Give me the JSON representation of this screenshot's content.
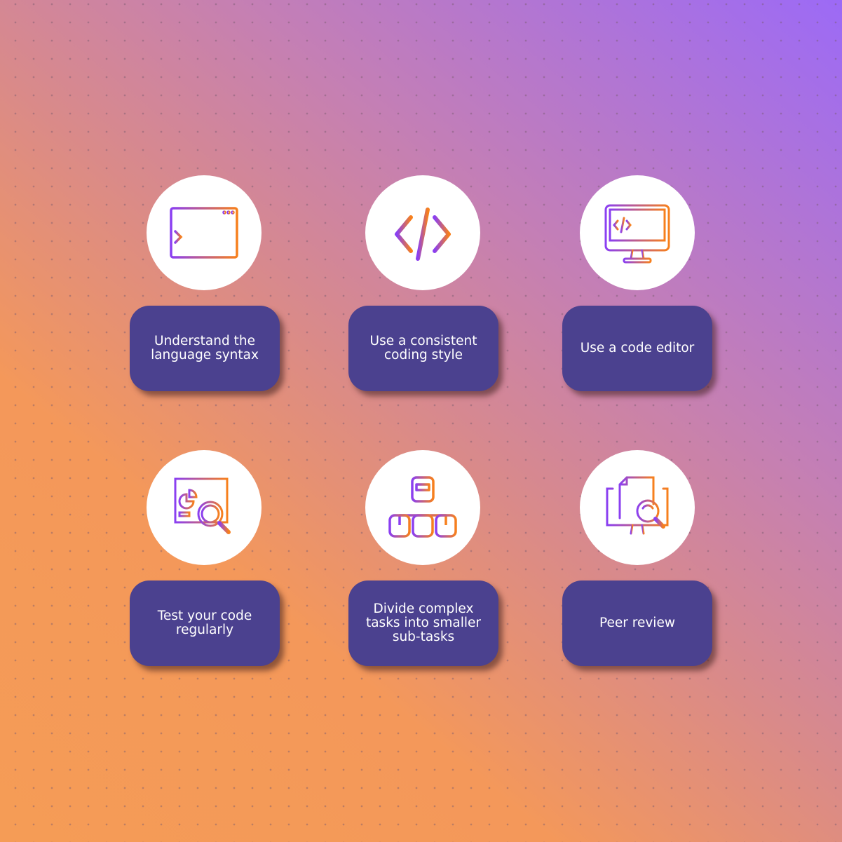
{
  "colors": {
    "card": "#4b418f",
    "icon_start": "#8a3ff2",
    "icon_end": "#f7801c",
    "bg_start": "#f59c56",
    "bg_end": "#9c6af6"
  },
  "items": [
    {
      "label": "Understand the language syntax",
      "icon": "terminal-window-icon"
    },
    {
      "label": "Use a consistent coding style",
      "icon": "code-brackets-icon"
    },
    {
      "label": "Use a code editor",
      "icon": "monitor-code-icon"
    },
    {
      "label": "Test your code regularly",
      "icon": "analytics-magnifier-icon"
    },
    {
      "label": "Divide complex tasks into smaller sub-tasks",
      "icon": "hierarchy-icon"
    },
    {
      "label": "Peer review",
      "icon": "document-review-icon"
    }
  ]
}
